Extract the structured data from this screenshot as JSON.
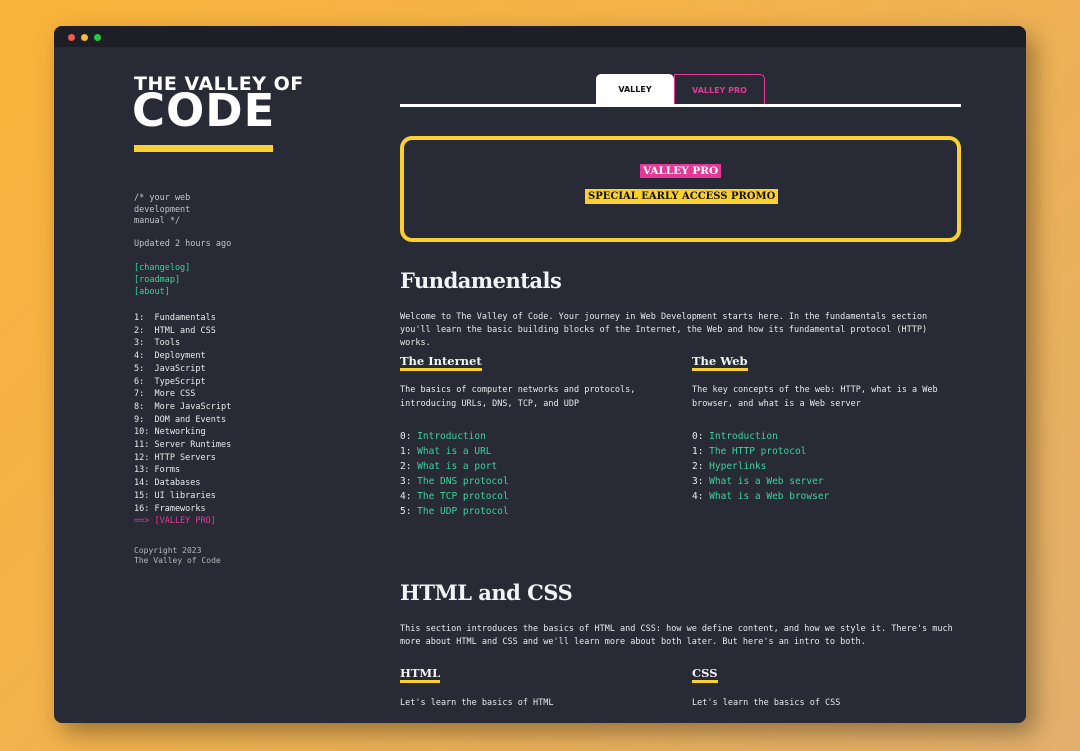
{
  "sidebar": {
    "logo_small": "THE VALLEY OF",
    "logo_big": "CODE",
    "tagline": "/* your web\ndevelopment\nmanual */",
    "updated": "Updated 2 hours ago",
    "links": [
      "[changelog]",
      "[roadmap]",
      "[about]"
    ],
    "toc": [
      "1:  Fundamentals",
      "2:  HTML and CSS",
      "3:  Tools",
      "4:  Deployment",
      "5:  JavaScript",
      "6:  TypeScript",
      "7:  More CSS",
      "8:  More JavaScript",
      "9:  DOM and Events",
      "10: Networking",
      "11: Server Runtimes",
      "12: HTTP Servers",
      "13: Forms",
      "14: Databases",
      "15: UI libraries",
      "16: Frameworks"
    ],
    "toc_pro": "==> [VALLEY PRO]",
    "copyright_line1": "Copyright 2023",
    "copyright_line2": "The Valley of Code"
  },
  "tabs": {
    "valley": "VALLEY",
    "pro": "VALLEY PRO"
  },
  "promo": {
    "badge": "VALLEY PRO",
    "subtitle": "SPECIAL EARLY ACCESS PROMO"
  },
  "fundamentals": {
    "title": "Fundamentals",
    "intro": "Welcome to The Valley of Code. Your journey in Web Development starts here. In the fundamentals section you'll learn the basic building blocks of the Internet, the Web and how its fundamental protocol (HTTP) works.",
    "internet": {
      "title": "The Internet",
      "desc": "The basics of computer networks and protocols, introducing URLs, DNS, TCP, and UDP",
      "lessons": [
        "Introduction",
        "What is a URL",
        "What is a port",
        "The DNS protocol",
        "The TCP protocol",
        "The UDP protocol"
      ]
    },
    "web": {
      "title": "The Web",
      "desc": "The key concepts of the web: HTTP, what is a Web browser, and what is a Web server",
      "lessons": [
        "Introduction",
        "The HTTP protocol",
        "Hyperlinks",
        "What is a Web server",
        "What is a Web browser"
      ]
    }
  },
  "htmlcss": {
    "title": "HTML and CSS",
    "intro": "This section introduces the basics of HTML and CSS: how we define content, and how we style it. There's much more about HTML and CSS and we'll learn more about both later. But here's an intro to both.",
    "html": {
      "title": "HTML",
      "desc": "Let's learn the basics of HTML"
    },
    "css": {
      "title": "CSS",
      "desc": "Let's learn the basics of CSS"
    }
  },
  "colors": {
    "accent_yellow": "#f9d02f",
    "accent_pink": "#e53899",
    "link_green": "#39d39f",
    "background": "#282a35"
  }
}
